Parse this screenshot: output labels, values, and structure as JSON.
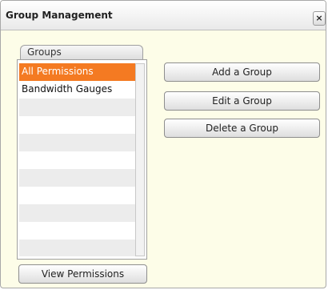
{
  "window": {
    "title": "Group Management",
    "close_label": "×"
  },
  "groups_panel": {
    "tab_label": "Groups",
    "items": [
      {
        "label": "All Permissions",
        "selected": true
      },
      {
        "label": "Bandwidth Gauges",
        "selected": false
      }
    ]
  },
  "actions": {
    "add_label": "Add a Group",
    "edit_label": "Edit a Group",
    "delete_label": "Delete a Group",
    "view_permissions_label": "View Permissions"
  },
  "colors": {
    "selection": "#f47a22",
    "panel_background": "#fdfde8"
  }
}
